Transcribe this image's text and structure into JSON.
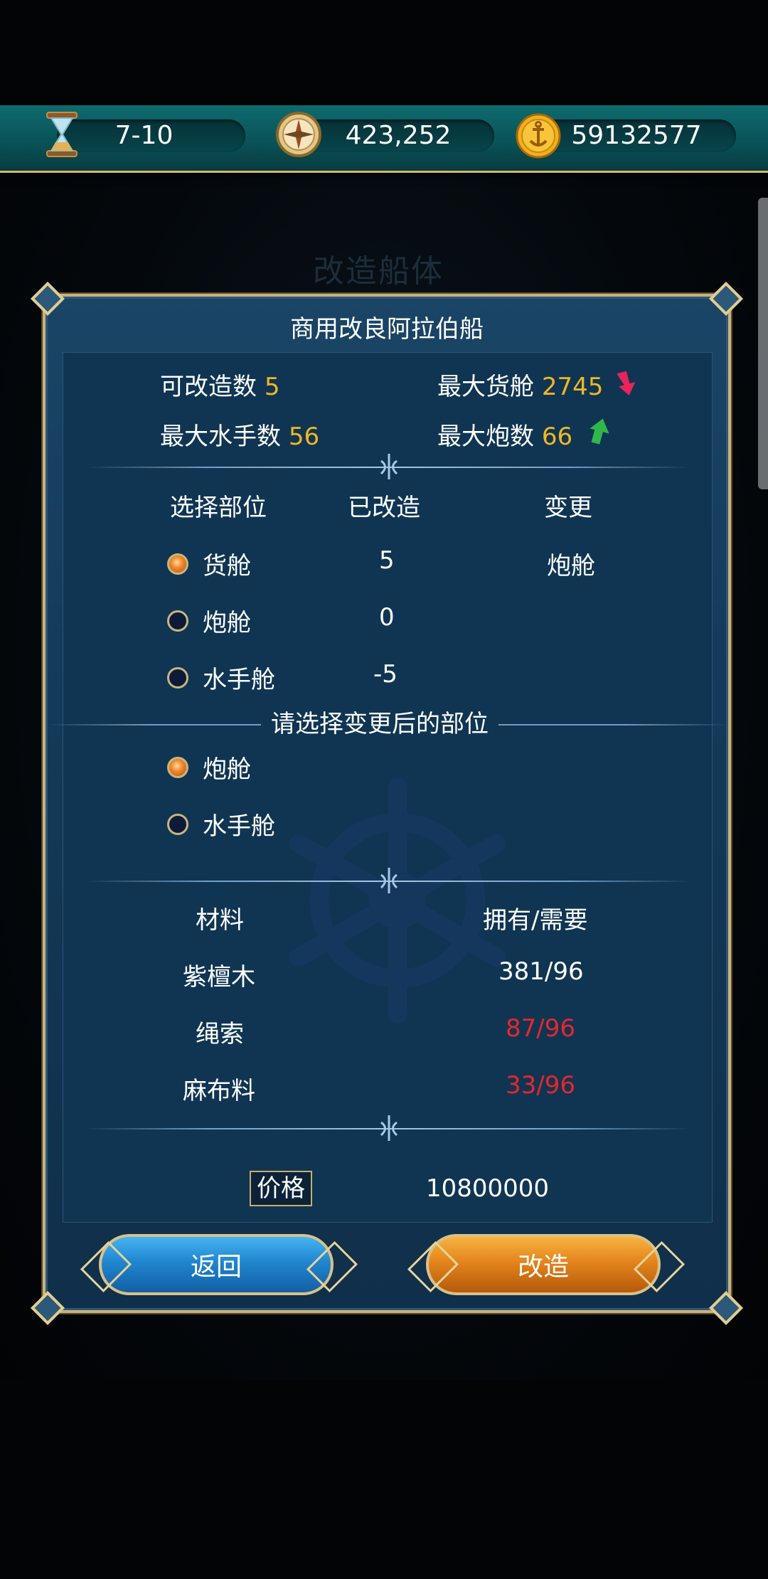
{
  "topbar": {
    "time_value": "7-10",
    "compass_value": "423,252",
    "gold_value": "59132577"
  },
  "background": {
    "title": "改造船体"
  },
  "dialog": {
    "title": "商用改良阿拉伯船",
    "stats": {
      "mod_count_label": "可改造数",
      "mod_count_value": "5",
      "max_cargo_label": "最大货舱",
      "max_cargo_value": "2745",
      "max_sailors_label": "最大水手数",
      "max_sailors_value": "56",
      "max_cannon_label": "最大炮数",
      "max_cannon_value": "66"
    },
    "parts_table": {
      "headers": [
        "选择部位",
        "已改造",
        "变更"
      ],
      "rows": [
        {
          "part": "货舱",
          "modified": "5",
          "change": "炮舱",
          "selected": true
        },
        {
          "part": "炮舱",
          "modified": "0",
          "change": "",
          "selected": false
        },
        {
          "part": "水手舱",
          "modified": "-5",
          "change": "",
          "selected": false
        }
      ]
    },
    "change_prompt": "请选择变更后的部位",
    "change_options": [
      {
        "label": "炮舱",
        "selected": true
      },
      {
        "label": "水手舱",
        "selected": false
      }
    ],
    "materials": {
      "headers": [
        "材料",
        "拥有/需要"
      ],
      "rows": [
        {
          "name": "紫檀木",
          "amount": "381/96",
          "sufficient": true
        },
        {
          "name": "绳索",
          "amount": "87/96",
          "sufficient": false
        },
        {
          "name": "麻布料",
          "amount": "33/96",
          "sufficient": false
        }
      ]
    },
    "price_label": "价格",
    "price_value": "10800000",
    "back_button": "返回",
    "modify_button": "改造"
  },
  "colors": {
    "highlight": "#f3b623",
    "insufficient": "#e8262b",
    "arrow_down": "#e8245a",
    "arrow_up": "#2fb84a"
  }
}
